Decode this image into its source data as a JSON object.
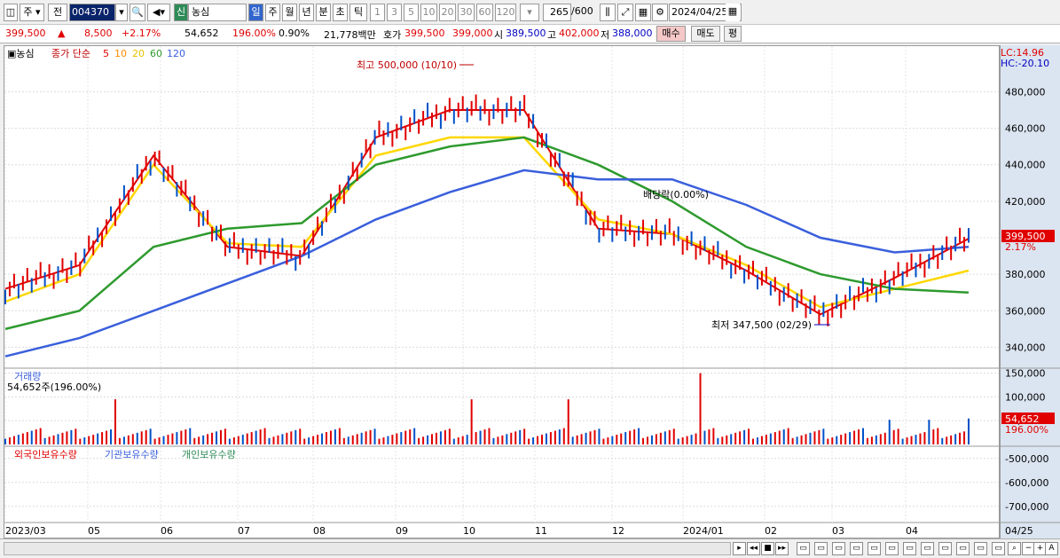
{
  "toolbar": {
    "market": "주",
    "prev": "전",
    "code": "004370",
    "badge": "신",
    "name": "농심",
    "periods": [
      "일",
      "주",
      "월",
      "년",
      "분",
      "초",
      "틱"
    ],
    "nums": [
      "1",
      "3",
      "5",
      "10",
      "20",
      "30",
      "60",
      "120"
    ],
    "count": "265",
    "count_total": "/600",
    "date": "2024/04/25"
  },
  "quote": {
    "price": "399,500",
    "arrow": "▲",
    "change": "8,500",
    "rate": "+2.17%",
    "volume": "54,652",
    "vol_ratio": "196.00%",
    "turnover": "0.90%",
    "amount": "21,778백만",
    "hoga_label": "호가",
    "bid": "399,500",
    "ask": "399,000",
    "open_label": "시",
    "open": "389,500",
    "high_label": "고",
    "high": "402,000",
    "low_label": "저",
    "low": "388,000",
    "buy": "매수",
    "sell": "매도",
    "eval": "평"
  },
  "legend": {
    "name": "농심",
    "ma_label": "종가 단순",
    "ma": [
      "5",
      "10",
      "20",
      "60",
      "120"
    ]
  },
  "annotations": {
    "high": "최고 500,000 (10/10)",
    "low": "최저 347,500 (02/29)",
    "dividend": "배당락(0.00%)"
  },
  "lc": "LC:14.96",
  "hc": "HC:-20.10",
  "price_badge": "399,500",
  "rate_badge": "2.17%",
  "volume": {
    "title": "거래량",
    "value": "54,652주(196.00%)",
    "badge": "54,652",
    "badge_pct": "196.00%"
  },
  "holdings": {
    "labels": [
      "외국인보유수량",
      "기관보유수량",
      "개인보유수량"
    ]
  },
  "x_labels": [
    "2023/03",
    "05",
    "06",
    "07",
    "08",
    "09",
    "10",
    "11",
    "12",
    "2024/01",
    "02",
    "03",
    "04"
  ],
  "x_right": "04/25",
  "chart_data": [
    {
      "type": "line",
      "title": "",
      "series_names": [
        "종가",
        "5",
        "10",
        "20",
        "60",
        "120"
      ],
      "x": [
        "2023/03",
        "05",
        "06",
        "07",
        "08",
        "09",
        "10",
        "11",
        "12",
        "2024/01",
        "02",
        "03",
        "04"
      ],
      "ylim": [
        330000,
        505000
      ],
      "y_ticks": [
        340000,
        360000,
        380000,
        400000,
        420000,
        440000,
        460000,
        480000
      ],
      "series": [
        {
          "name": "5",
          "values": [
            372000,
            385000,
            445000,
            395000,
            390000,
            455000,
            470000,
            470000,
            405000,
            402000,
            382000,
            358000,
            378000,
            399500
          ]
        },
        {
          "name": "20",
          "values": [
            365000,
            380000,
            440000,
            397000,
            395000,
            445000,
            455000,
            455000,
            410000,
            402000,
            385000,
            362000,
            372000,
            382000
          ]
        },
        {
          "name": "60",
          "values": [
            350000,
            360000,
            395000,
            405000,
            408000,
            440000,
            450000,
            455000,
            440000,
            420000,
            395000,
            380000,
            372000,
            370000
          ]
        },
        {
          "name": "120",
          "values": [
            335000,
            345000,
            360000,
            375000,
            390000,
            410000,
            425000,
            437000,
            432000,
            432000,
            418000,
            400000,
            392000,
            395000
          ]
        }
      ],
      "high": 500000,
      "low": 347500
    },
    {
      "type": "bar",
      "title": "거래량",
      "ylim": [
        0,
        155000
      ],
      "y_ticks": [
        50000,
        100000,
        150000
      ],
      "last": 54652
    },
    {
      "type": "line",
      "title": "",
      "ylim": [
        -760000,
        -460000
      ],
      "y_ticks": [
        -500000,
        -600000,
        -700000
      ]
    }
  ]
}
